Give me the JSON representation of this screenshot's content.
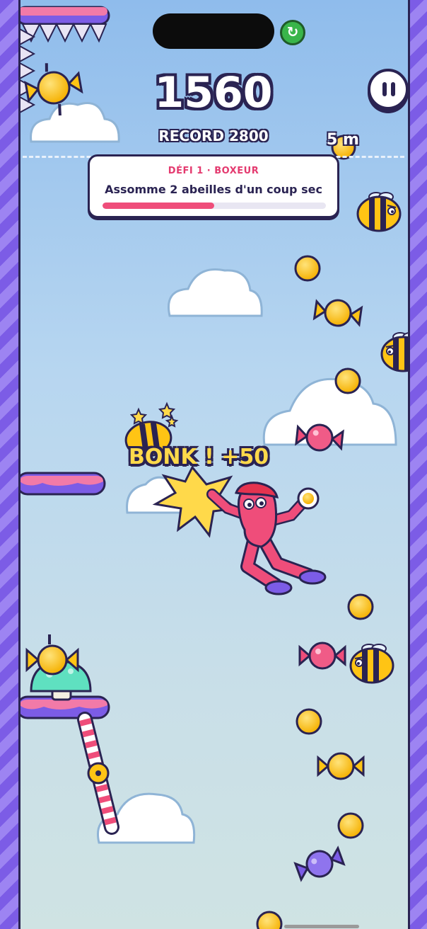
{
  "hud": {
    "score": "1560",
    "record": "RECORD 2800",
    "height": "5 m"
  },
  "challenge": {
    "title": "DÉFI 1 · BOXEUR",
    "description": "Assomme 2 abeilles d'un coup sec",
    "progress": 0.5
  },
  "popup": {
    "text": "BONK ! +50"
  },
  "icons": {
    "restart": "restart-icon",
    "pause": "pause-icon"
  },
  "colors": {
    "accent": "#ef4d7a",
    "outline": "#2a2352",
    "coin": "#ffc414",
    "wall": "#7c5ce6"
  }
}
